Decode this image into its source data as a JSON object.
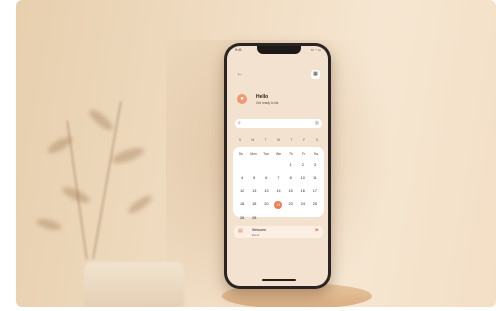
{
  "colors": {
    "accent": "#ee7b55",
    "background": "#f3e2cf",
    "card": "#ffffff"
  },
  "status": {
    "time": "9:41",
    "icons": "▪▪ ◔ ▭"
  },
  "header": {
    "back_icon": "arrow-left-icon",
    "menu_icon": "grid-icon"
  },
  "profile": {
    "avatar_icon": "person-icon",
    "greeting": "Hello",
    "subline": "Get ready to list"
  },
  "search": {
    "placeholder": "",
    "icon": "search-icon",
    "filter_icon": "filter-icon"
  },
  "week_strip": [
    "S",
    "M",
    "T",
    "W",
    "T",
    "F",
    "S"
  ],
  "calendar": {
    "day_headers": [
      "Sn",
      "Mon",
      "Tue",
      "We",
      "Th",
      "Fr",
      "Sa"
    ],
    "days": [
      {
        "label": ""
      },
      {
        "label": ""
      },
      {
        "label": ""
      },
      {
        "label": ""
      },
      {
        "label": "1"
      },
      {
        "label": "2"
      },
      {
        "label": "3"
      },
      {
        "label": "4"
      },
      {
        "label": "5"
      },
      {
        "label": "6"
      },
      {
        "label": "7"
      },
      {
        "label": "8"
      },
      {
        "label": "10"
      },
      {
        "label": "11"
      },
      {
        "label": "12"
      },
      {
        "label": "13"
      },
      {
        "label": "13"
      },
      {
        "label": "14"
      },
      {
        "label": "15"
      },
      {
        "label": "16"
      },
      {
        "label": "17"
      },
      {
        "label": "18"
      },
      {
        "label": "18"
      },
      {
        "label": "20"
      },
      {
        "label": "21",
        "selected": true
      },
      {
        "label": "23"
      },
      {
        "label": "24"
      },
      {
        "label": "25"
      },
      {
        "label": "26"
      },
      {
        "label": "28"
      }
    ]
  },
  "event": {
    "icon": "calendar-icon",
    "title": "Welcome",
    "subtitle": "Event",
    "flag_icon": "flag-icon"
  }
}
